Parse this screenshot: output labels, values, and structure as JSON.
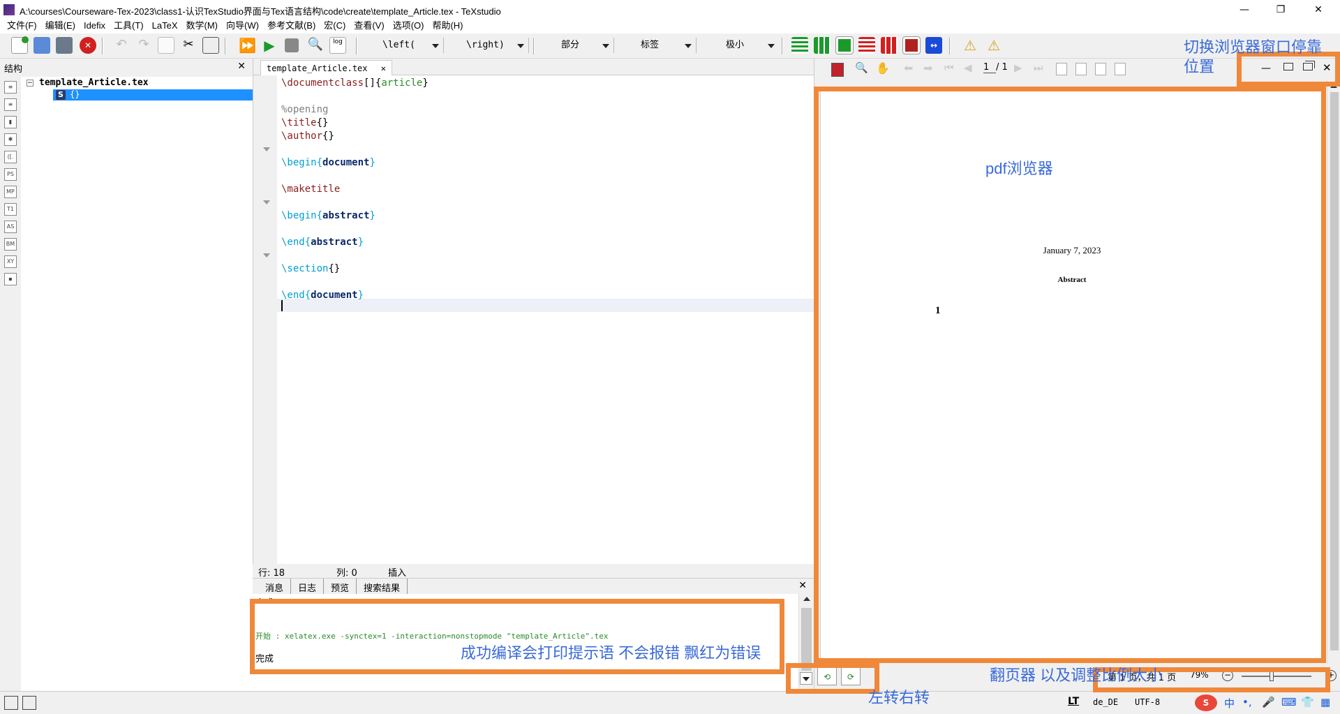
{
  "window": {
    "title": "A:\\courses\\Courseware-Tex-2023\\class1-认识TexStudio界面与Tex语言结构\\code\\create\\template_Article.tex - TeXstudio",
    "minimize": "—",
    "restore": "❐",
    "close": "✕"
  },
  "menu": [
    "文件(F)",
    "编辑(E)",
    "Idefix",
    "工具(T)",
    "LaTeX",
    "数学(M)",
    "向导(W)",
    "参考文献(B)",
    "宏(C)",
    "查看(V)",
    "选项(O)",
    "帮助(H)"
  ],
  "toolbar": {
    "left_combo": "\\left(",
    "right_combo": "\\right)",
    "section_combo": "部分",
    "label_combo": "标签",
    "size_combo": "极小",
    "log_label": "log"
  },
  "structure": {
    "title": "结构",
    "close": "✕",
    "root": "template_Article.tex",
    "child_badge": "S",
    "child_label": "{}",
    "side_icons": [
      "≡",
      "≡",
      "▮",
      "✱",
      "([.",
      "PS",
      "MP",
      "T1",
      "AS",
      "BM",
      "XY",
      "▪"
    ]
  },
  "editor": {
    "tab_label": "template_Article.tex",
    "tab_close": "✕",
    "lines": [
      {
        "cmd": "\\documentclass",
        "mid": "[]{",
        "arg": "article",
        "end": "}"
      },
      {
        "text": ""
      },
      {
        "comment": "%opening"
      },
      {
        "cmd": "\\title",
        "end": "{}"
      },
      {
        "cmd": "\\author",
        "end": "{}"
      },
      {
        "text": ""
      },
      {
        "kw": "\\begin",
        "arg": "document"
      },
      {
        "text": ""
      },
      {
        "cmd": "\\maketitle"
      },
      {
        "text": ""
      },
      {
        "kw": "\\begin",
        "arg": "abstract"
      },
      {
        "text": ""
      },
      {
        "kw": "\\end",
        "arg": "abstract"
      },
      {
        "text": ""
      },
      {
        "kw": "\\section",
        "end": "{}"
      },
      {
        "text": ""
      },
      {
        "kw": "\\end",
        "arg": "document"
      }
    ],
    "status_row": "行: 18",
    "status_col": "列: 0",
    "status_mode": "插入"
  },
  "messages": {
    "tabs": [
      "消息",
      "日志",
      "预览",
      "搜索结果"
    ],
    "close": "✕",
    "top_line": "完成",
    "start_label": "开始",
    "command": " : xelatex.exe -synctex=1 -interaction=nonstopmode \"template_Article\".tex",
    "done": "完成"
  },
  "pdf": {
    "page_input": "1",
    "page_total": "/ 1",
    "date": "January 7, 2023",
    "abstract": "Abstract",
    "section_number": "1",
    "page_status": "第 1 页，共 1 页",
    "zoom": "79%"
  },
  "statusbar": {
    "lang": "de_DE",
    "encoding": "UTF-8",
    "lt": "LT"
  },
  "annotations": {
    "dock_switch": "切换浏览器窗口停靠位置",
    "pdf_viewer": "pdf浏览器",
    "compile_msg": "成功编译会打印提示语 不会报错 飘红为错误",
    "rotate": "左转右转",
    "pager": "翻页器 以及调整比例大小"
  },
  "colors": {
    "annotation_box": "#f0883a",
    "annotation_text": "#3a6ad8",
    "keyword": "#00a0d0",
    "command": "#8a2020",
    "compile_start": "#2a8a2a"
  }
}
